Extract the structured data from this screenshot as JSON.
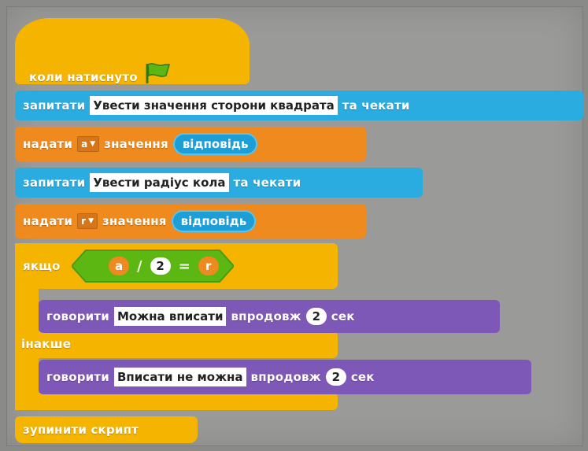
{
  "hat": {
    "label": "коли натиснуто",
    "icon": "green-flag-icon"
  },
  "ask1": {
    "verb": "запитати",
    "question": "Увести значення сторони квадрата",
    "suffix": "та чекати"
  },
  "set1": {
    "verb": "надати",
    "variable": "a",
    "middle": "значення",
    "reporter": "відповідь"
  },
  "ask2": {
    "verb": "запитати",
    "question": "Увести радіус кола",
    "suffix": "та чекати"
  },
  "set2": {
    "verb": "надати",
    "variable": "r",
    "middle": "значення",
    "reporter": "відповідь"
  },
  "ifelse": {
    "if_label": "якщо",
    "condition": {
      "left_var": "a",
      "divide": "/",
      "divisor": "2",
      "equals": "=",
      "right_var": "r"
    },
    "else_label": "інакше"
  },
  "say1": {
    "verb": "говорити",
    "text": "Можна вписати",
    "middle": "впродовж",
    "seconds": "2",
    "unit": "сек"
  },
  "say2": {
    "verb": "говорити",
    "text": "Вписати не можна",
    "middle": "впродовж",
    "seconds": "2",
    "unit": "сек"
  },
  "stop": {
    "label": "зупинити скрипт"
  },
  "colors": {
    "events": "#f4b400",
    "sensing": "#2bace0",
    "data": "#ee8a1e",
    "looks": "#7e58b7",
    "operators": "#5cb712",
    "control": "#f4b400"
  }
}
